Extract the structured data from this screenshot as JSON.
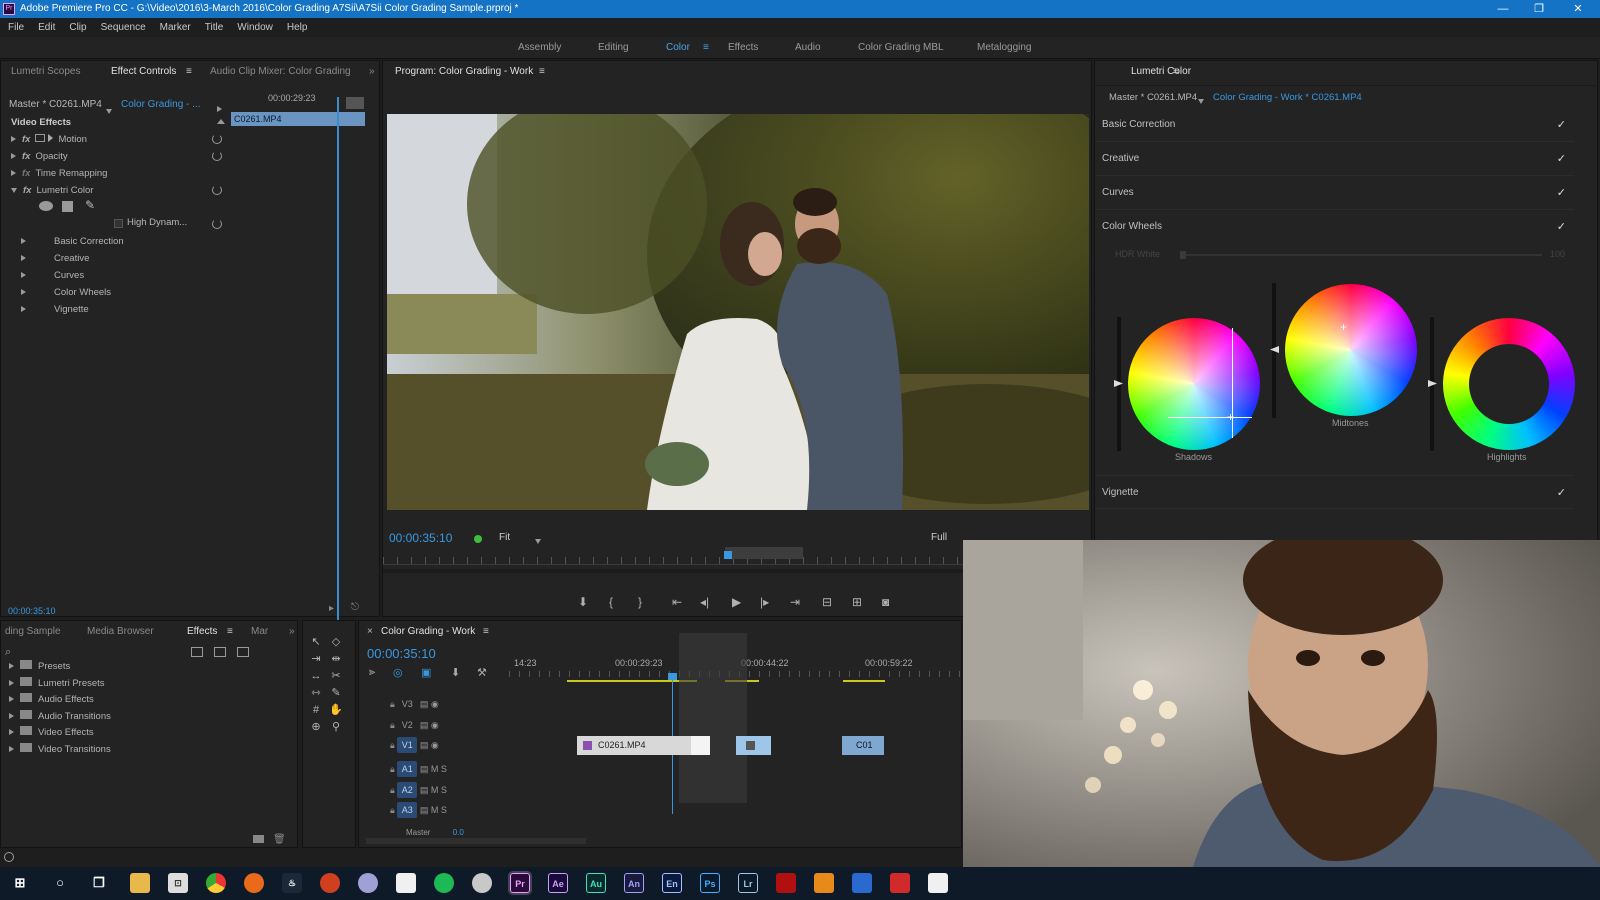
{
  "window": {
    "title": "Adobe Premiere Pro CC - G:\\Video\\2016\\3-March 2016\\Color Grading A7Sii\\A7Sii Color Grading Sample.prproj *",
    "app_badge": "Pr"
  },
  "menu": [
    "File",
    "Edit",
    "Clip",
    "Sequence",
    "Marker",
    "Title",
    "Window",
    "Help"
  ],
  "workspaces": [
    "Assembly",
    "Editing",
    "Color",
    "Effects",
    "Audio",
    "Color Grading MBL",
    "Metalogging"
  ],
  "active_workspace": "Color",
  "effect_controls": {
    "tabs": [
      "Lumetri Scopes",
      "Effect Controls",
      "Audio Clip Mixer: Color Grading"
    ],
    "master_label": "Master * C0261.MP4",
    "sequence_label": "Color Grading - ...",
    "timecode_top": "00:00:29:23",
    "clip_label": "C0261.MP4",
    "section": "Video Effects",
    "effects": [
      "Motion",
      "Opacity",
      "Time Remapping",
      "Lumetri Color"
    ],
    "hdr_label": "High Dynam...",
    "subsections": [
      "Basic Correction",
      "Creative",
      "Curves",
      "Color Wheels",
      "Vignette"
    ],
    "timecode_bottom": "00:00:35:10"
  },
  "program_monitor": {
    "title": "Program: Color Grading - Work",
    "timecode": "00:00:35:10",
    "fit": "Fit",
    "quality": "Full"
  },
  "lumetri": {
    "title": "Lumetri Color",
    "master": "Master * C0261.MP4",
    "sequence": "Color Grading - Work * C0261.MP4",
    "sections": [
      "Basic Correction",
      "Creative",
      "Curves",
      "Color Wheels",
      "Vignette"
    ],
    "hdr_white": "HDR White",
    "hdr_value": "100",
    "wheels": [
      "Shadows",
      "Midtones",
      "Highlights"
    ]
  },
  "project_panel": {
    "tabs": [
      "ding Sample",
      "Media Browser",
      "Effects",
      "Mar"
    ],
    "items": [
      "Presets",
      "Lumetri Presets",
      "Audio Effects",
      "Audio Transitions",
      "Video Effects",
      "Video Transitions"
    ]
  },
  "timeline": {
    "title": "Color Grading - Work",
    "timecode": "00:00:35:10",
    "ruler": [
      "14:23",
      "00:00:29:23",
      "00:00:44:22",
      "00:00:59:22"
    ],
    "tracks": [
      "V3",
      "V2",
      "V1",
      "A1",
      "A2",
      "A3"
    ],
    "master_label": "Master",
    "master_value": "0.0",
    "clip_main": "C0261.MP4",
    "clip_right": "C01"
  },
  "taskbar_apps": [
    "Pr",
    "Ae",
    "Au",
    "An",
    "En",
    "Ps",
    "Lr"
  ]
}
